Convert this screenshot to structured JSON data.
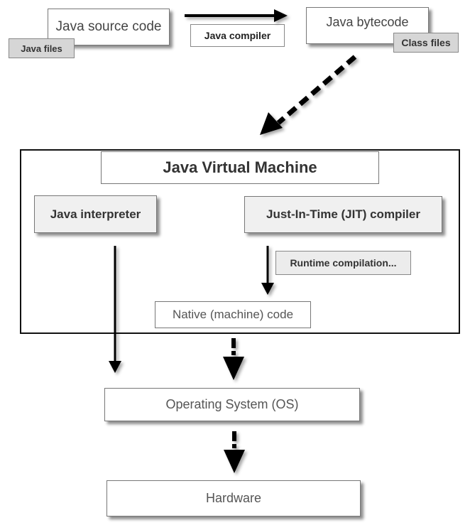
{
  "diagram": {
    "source": {
      "label": "Java source code",
      "tag": "Java files"
    },
    "compiler": {
      "label": "Java compiler"
    },
    "bytecode": {
      "label": "Java bytecode",
      "tag": "Class files"
    },
    "jvm": {
      "title": "Java Virtual Machine",
      "interpreter": "Java interpreter",
      "jit": "Just-In-Time (JIT) compiler",
      "runtime_note": "Runtime compilation...",
      "native": "Native (machine) code"
    },
    "os": {
      "label": "Operating System (OS)"
    },
    "hardware": {
      "label": "Hardware"
    }
  }
}
